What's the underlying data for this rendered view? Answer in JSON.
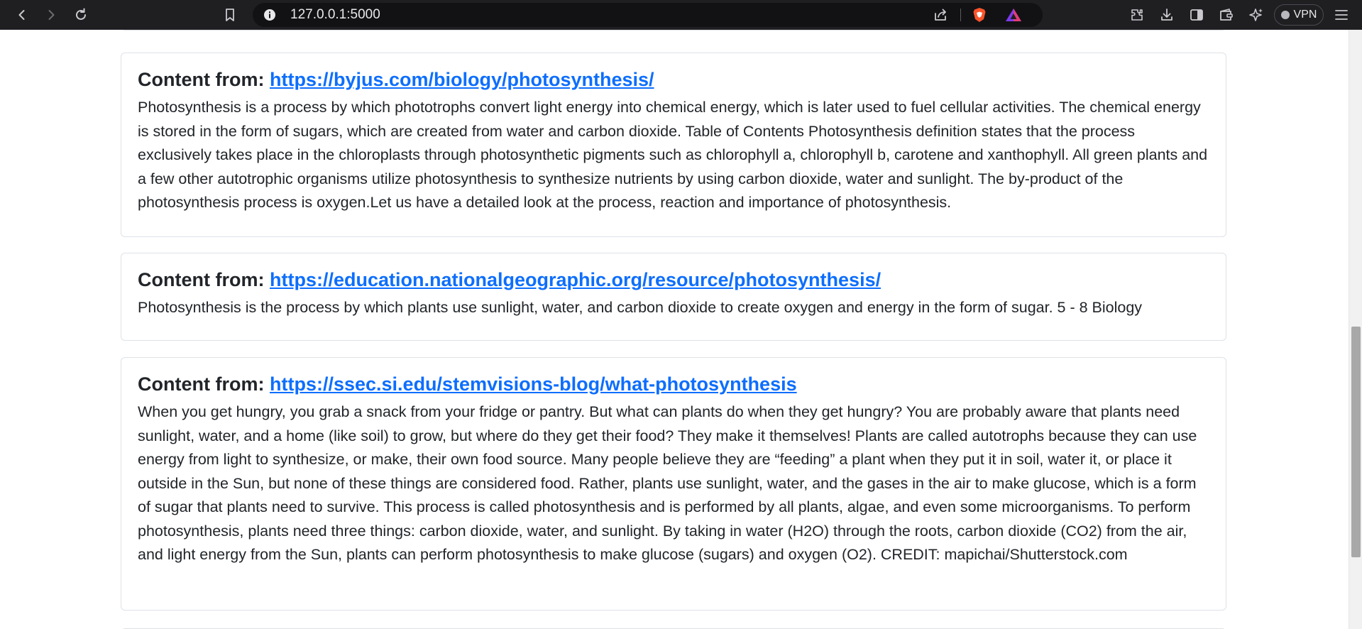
{
  "browser": {
    "url": "127.0.0.1:5000",
    "vpn_label": "VPN",
    "icons": [
      "back-icon",
      "forward-icon",
      "reload-icon",
      "bookmark-icon",
      "site-info-icon",
      "share-icon",
      "brave-shields-icon",
      "brave-rewards-icon",
      "extensions-icon",
      "downloads-icon",
      "sidebar-icon",
      "wallet-icon",
      "leo-ai-icon",
      "menu-icon"
    ]
  },
  "results": [
    {
      "label": "Content from:",
      "url": "https://byjus.com/biology/photosynthesis/",
      "text": "Photosynthesis is a process by which phototrophs convert light energy into chemical energy, which is later used to fuel cellular activities. The chemical energy is stored in the form of sugars, which are created from water and carbon dioxide. Table of Contents Photosynthesis definition states that the process exclusively takes place in the chloroplasts through photosynthetic pigments such as chlorophyll a, chlorophyll b, carotene and xanthophyll. All green plants and a few other autotrophic organisms utilize photosynthesis to synthesize nutrients by using carbon dioxide, water and sunlight. The by-product of the photosynthesis process is oxygen.Let us have a detailed look at the process, reaction and importance of photosynthesis."
    },
    {
      "label": "Content from:",
      "url": "https://education.nationalgeographic.org/resource/photosynthesis/",
      "text": "Photosynthesis is the process by which plants use sunlight, water, and carbon dioxide to create oxygen and energy in the form of sugar. 5 - 8 Biology"
    },
    {
      "label": "Content from:",
      "url": "https://ssec.si.edu/stemvisions-blog/what-photosynthesis",
      "text": "When you get hungry, you grab a snack from your fridge or pantry. But what can plants do when they get hungry? You are probably aware that plants need sunlight, water, and a home (like soil) to grow, but where do they get their food? They make it themselves! Plants are called autotrophs because they can use energy from light to synthesize, or make, their own food source. Many people believe they are “feeding” a plant when they put it in soil, water it, or place it outside in the Sun, but none of these things are considered food. Rather, plants use sunlight, water, and the gases in the air to make glucose, which is a form of sugar that plants need to survive. This process is called photosynthesis and is performed by all plants, algae, and even some microorganisms. To perform photosynthesis, plants need three things: carbon dioxide, water, and sunlight. By taking in water (H2O) through the roots, carbon dioxide (CO2) from the air, and light energy from the Sun, plants can perform photosynthesis to make glucose (sugars) and oxygen (O2). CREDIT: mapichai/Shutterstock.com"
    }
  ],
  "colors": {
    "link": "#0d6efd",
    "card_border": "#dee2e6",
    "chrome_bg": "#1f1f22"
  }
}
